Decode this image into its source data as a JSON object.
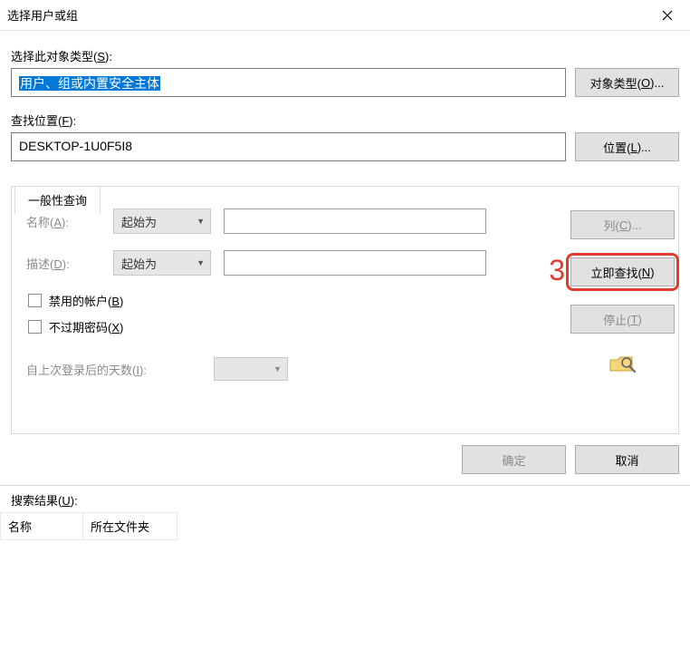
{
  "window": {
    "title": "选择用户或组"
  },
  "objectType": {
    "label": "选择此对象类型(S):",
    "value": "用户、组或内置安全主体",
    "button": "对象类型(O)..."
  },
  "location": {
    "label": "查找位置(F):",
    "value": "DESKTOP-1U0F5I8",
    "button": "位置(L)..."
  },
  "tab": {
    "label": "一般性查询"
  },
  "query": {
    "nameLabel": "名称(A):",
    "descLabel": "描述(D):",
    "comboOption": "起始为",
    "disabledAccounts": "禁用的帐户(B)",
    "neverExpire": "不过期密码(X)",
    "daysSinceLogin": "自上次登录后的天数(I):"
  },
  "sideButtons": {
    "columns": "列(C)...",
    "findNow": "立即查找(N)",
    "stop": "停止(T)"
  },
  "annotation": "3",
  "bottomButtons": {
    "ok": "确定",
    "cancel": "取消"
  },
  "results": {
    "label": "搜索结果(U):",
    "colName": "名称",
    "colFolder": "所在文件夹"
  }
}
